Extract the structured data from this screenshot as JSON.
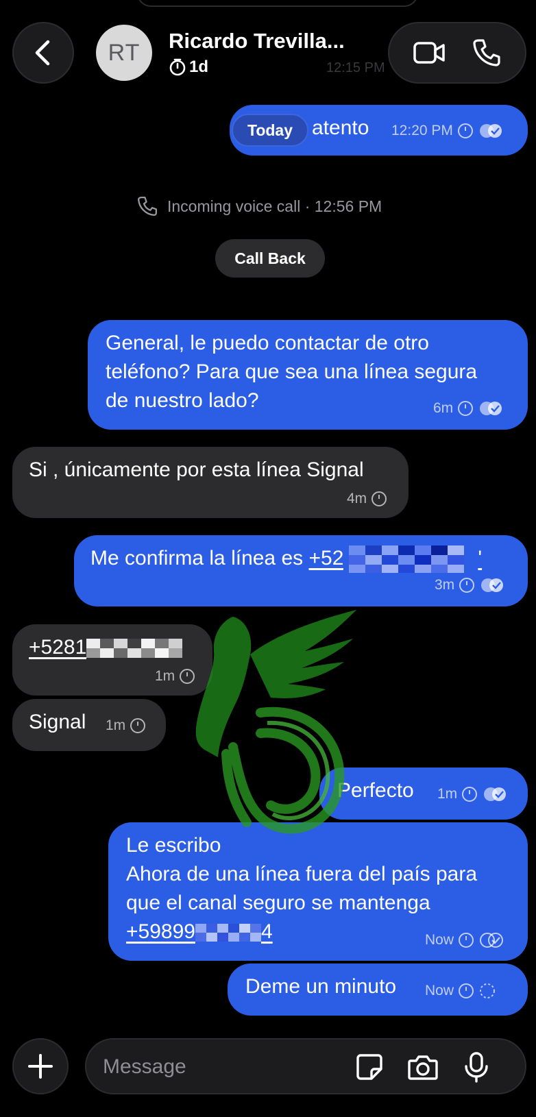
{
  "header": {
    "contact_name": "Ricardo Trevilla...",
    "avatar_initials": "RT",
    "disappearing_timer": "1d",
    "ghost_time": "12:15 PM",
    "back_icon": "chevron-left-icon",
    "video_icon": "video-camera-icon",
    "phone_icon": "phone-icon"
  },
  "conversation": {
    "date_divider": "Today",
    "call_event": "Incoming voice call · 12:56 PM",
    "call_back_label": "Call Back",
    "messages": [
      {
        "direction": "outgoing",
        "text": "atento",
        "time": "12:20 PM",
        "status": "read"
      },
      {
        "direction": "outgoing",
        "lines": [
          "General, le puedo contactar de otro",
          "teléfono? Para que sea una línea segura",
          "de nuestro lado?"
        ],
        "time": "6m",
        "status": "read"
      },
      {
        "direction": "incoming",
        "text": "Si , únicamente por esta línea Signal",
        "time": "4m"
      },
      {
        "direction": "outgoing",
        "text_prefix": "Me confirma la línea es ",
        "link": "+52",
        "link_suffix": "'",
        "time": "3m",
        "status": "read"
      },
      {
        "direction": "incoming",
        "link": "+5281",
        "time": "1m"
      },
      {
        "direction": "incoming",
        "text": "Signal",
        "time": "1m"
      },
      {
        "direction": "outgoing",
        "text": "Perfecto",
        "time": "1m",
        "status": "read"
      },
      {
        "direction": "outgoing",
        "lines": [
          "Le escribo",
          "Ahora de una línea fuera del país para",
          "que el canal seguro se mantenga"
        ],
        "link_prefix": "+59899",
        "link_suffix": "4",
        "time": "Now",
        "status": "delivered"
      },
      {
        "direction": "outgoing",
        "text": "Deme un minuto",
        "time": "Now",
        "status": "sending"
      }
    ]
  },
  "composer": {
    "placeholder": "Message",
    "plus_icon": "plus-icon",
    "sticker_icon": "sticker-icon",
    "camera_icon": "camera-icon",
    "mic_icon": "microphone-icon"
  },
  "colors": {
    "background": "#000000",
    "outgoing_bubble": "#2c5de5",
    "incoming_bubble": "#2c2c2e",
    "watermark": "#1f8a1a"
  }
}
